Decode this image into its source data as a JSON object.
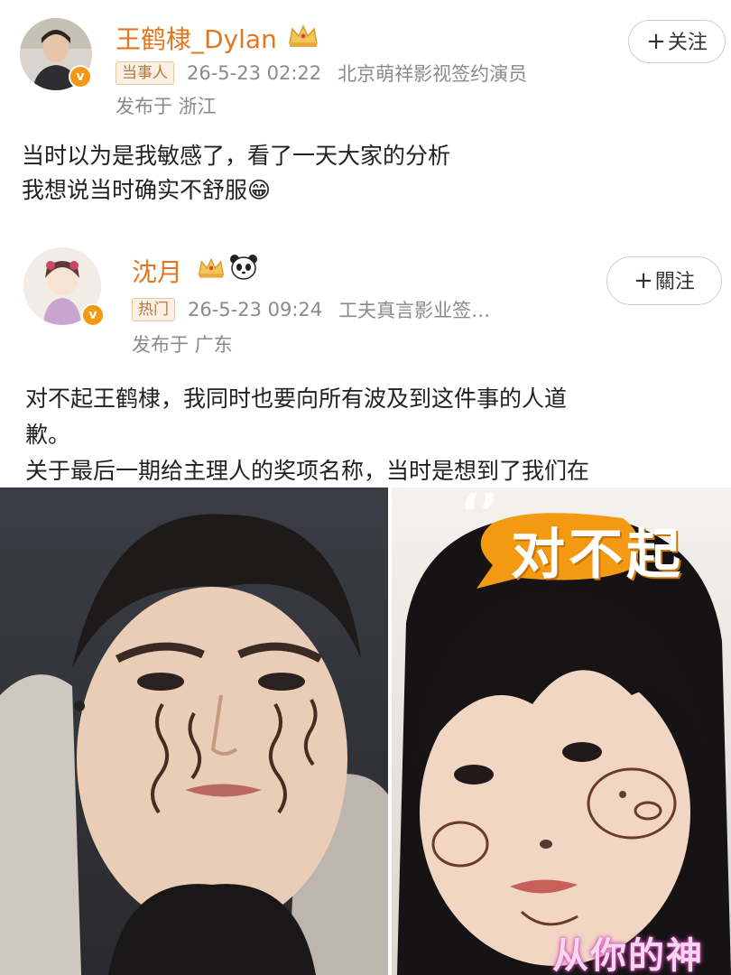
{
  "posts": [
    {
      "username": "王鹤棣_Dylan",
      "tag": "当事人",
      "time": "26-5-23 02:22",
      "source": "北京萌祥影视签约演员",
      "location": "发布于 浙江",
      "follow_label": "关注",
      "lines": [
        "当时以为是我敏感了，看了一天大家的分析",
        "我想说当时确实不舒服😁"
      ]
    },
    {
      "username": "沈月",
      "tag": "热门",
      "time": "26-5-23 09:24",
      "source": "工夫真言影业签…",
      "location": "发布于 广东",
      "follow_label": "關注",
      "lines": [
        "对不起王鹤棣，我同时也要向所有波及到这件事的人道",
        "歉。",
        "关于最后一期给主理人的奖项名称，当时是想到了我们在"
      ]
    }
  ],
  "photo": {
    "sticker_text": "对不起",
    "quote_marks": "‘’",
    "watermark": "从你的神"
  },
  "colors": {
    "username": "#e3771f",
    "verified": "#f39a12",
    "sticker": "#f39a12"
  }
}
